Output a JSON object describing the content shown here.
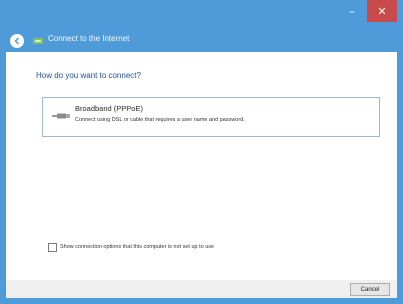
{
  "window": {
    "title": "Connect to the Internet",
    "controls": {
      "minimize": "–",
      "close": "✕"
    }
  },
  "main": {
    "question": "How do you want to connect?",
    "options": [
      {
        "title": "Broadband (PPPoE)",
        "description": "Connect using DSL or cable that requires a user name and password.",
        "icon": "broadband-cable-icon"
      }
    ],
    "checkbox": {
      "label": "Show connection options that this computer is not set up to use",
      "checked": false
    }
  },
  "footer": {
    "cancel_label": "Cancel"
  },
  "colors": {
    "chrome": "#4f9bd9",
    "close_button": "#c94a4a",
    "heading": "#1f4f98",
    "option_border": "#9fb8d8"
  }
}
